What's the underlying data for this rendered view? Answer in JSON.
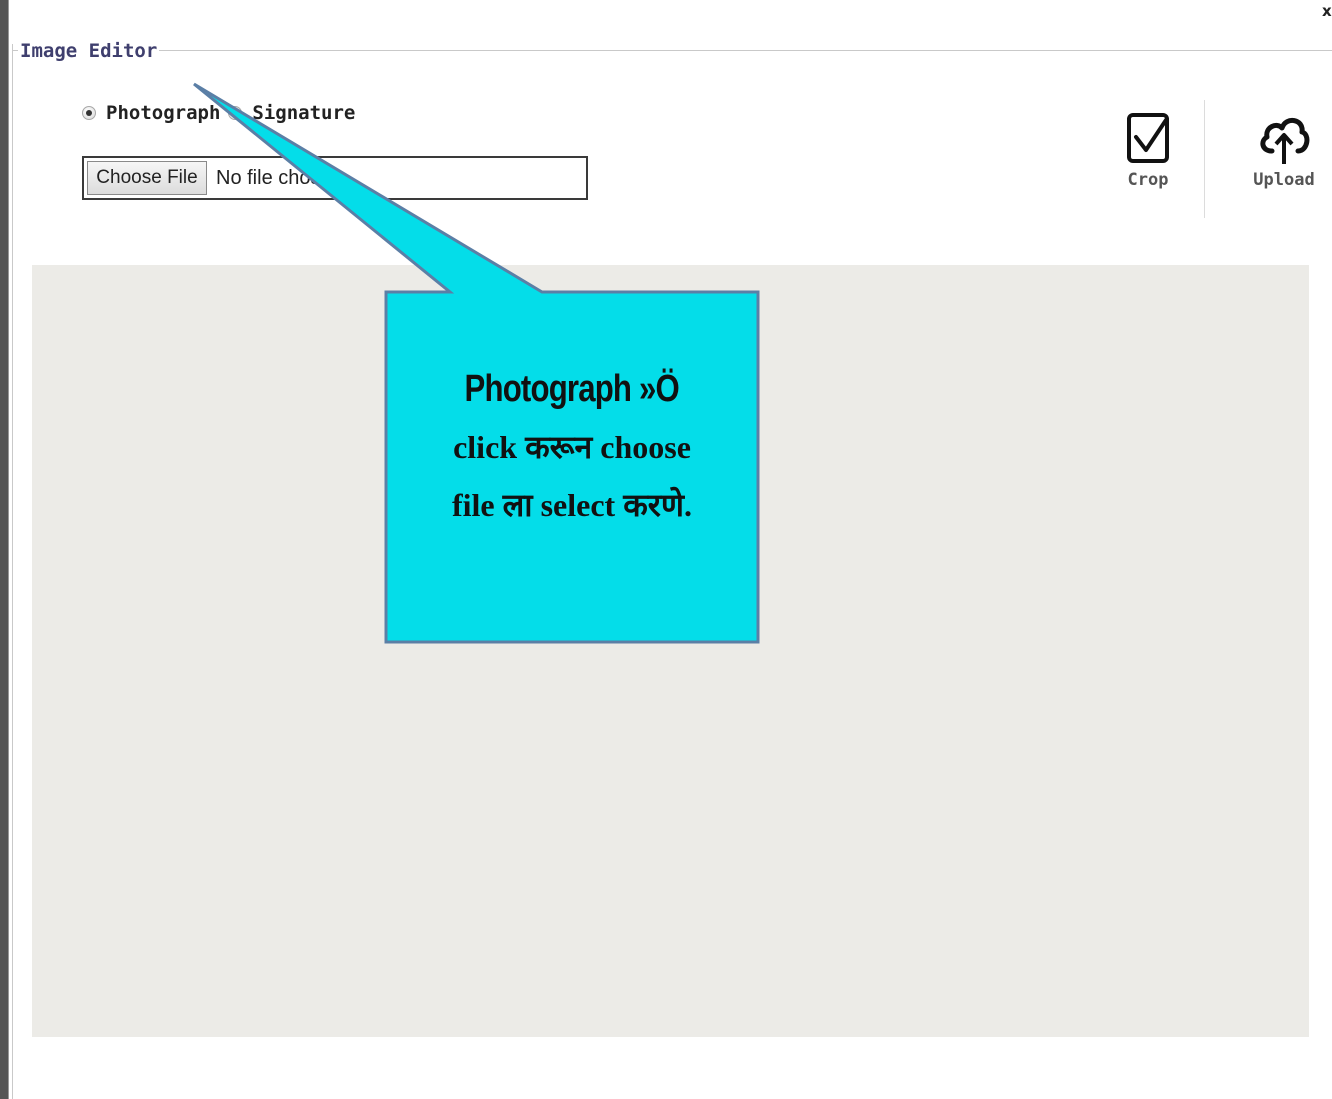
{
  "dialog": {
    "close_label": "x",
    "legend": "Image Editor"
  },
  "upload_type": {
    "options": [
      {
        "label": "Photograph",
        "selected": true
      },
      {
        "label": "Signature",
        "selected": false
      }
    ]
  },
  "file_input": {
    "button_label": "Choose File",
    "status": "No file chosen"
  },
  "toolbar": {
    "crop_label": "Crop",
    "upload_label": "Upload",
    "crop_icon": "checkbox-check-icon",
    "upload_icon": "cloud-upload-icon"
  },
  "callout": {
    "line1": "Photograph »Ö",
    "line2": "click करून choose",
    "line3": "file ला select करणे.",
    "fill_color": "#04dde9",
    "border_color": "#5b7fa6"
  },
  "colors": {
    "legend_text": "#3f3f6e",
    "canvas_bg": "#ecebe7"
  }
}
